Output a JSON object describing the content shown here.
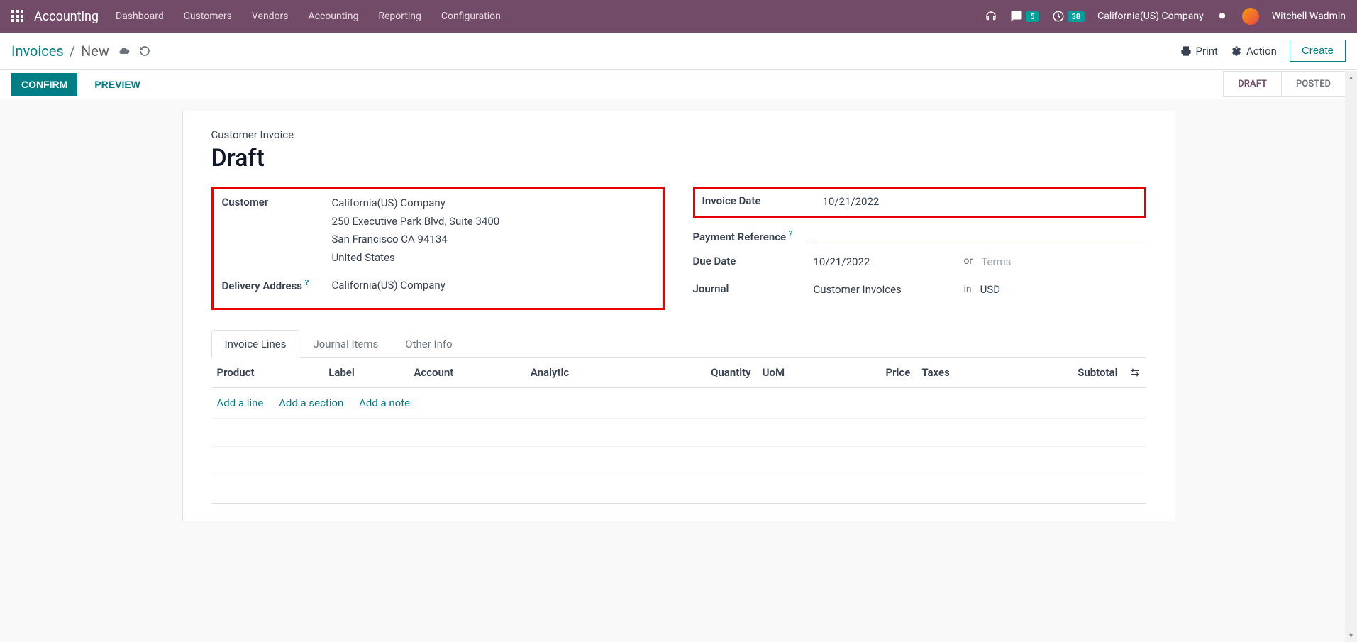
{
  "navbar": {
    "brand": "Accounting",
    "menu": [
      "Dashboard",
      "Customers",
      "Vendors",
      "Accounting",
      "Reporting",
      "Configuration"
    ],
    "messages_count": "5",
    "activities_count": "38",
    "company": "California(US) Company",
    "user": "Witchell Wadmin"
  },
  "control_panel": {
    "breadcrumb_root": "Invoices",
    "breadcrumb_current": "New",
    "print_label": "Print",
    "action_label": "Action",
    "create_label": "Create"
  },
  "status_bar": {
    "confirm": "CONFIRM",
    "preview": "PREVIEW",
    "draft": "DRAFT",
    "posted": "POSTED"
  },
  "form": {
    "subtitle": "Customer Invoice",
    "title": "Draft",
    "left": {
      "customer_label": "Customer",
      "customer_name": "California(US) Company",
      "address_line1": "250 Executive Park Blvd, Suite 3400",
      "address_line2": "San Francisco CA 94134",
      "address_line3": "United States",
      "delivery_label": "Delivery Address",
      "delivery_value": "California(US) Company"
    },
    "right": {
      "invoice_date_label": "Invoice Date",
      "invoice_date_value": "10/21/2022",
      "payment_ref_label": "Payment Reference",
      "payment_ref_value": "",
      "due_date_label": "Due Date",
      "due_date_value": "10/21/2022",
      "due_or": "or",
      "due_terms_placeholder": "Terms",
      "journal_label": "Journal",
      "journal_value": "Customer Invoices",
      "journal_in": "in",
      "journal_currency": "USD"
    },
    "tabs": [
      "Invoice Lines",
      "Journal Items",
      "Other Info"
    ],
    "columns": {
      "product": "Product",
      "label": "Label",
      "account": "Account",
      "analytic": "Analytic",
      "quantity": "Quantity",
      "uom": "UoM",
      "price": "Price",
      "taxes": "Taxes",
      "subtotal": "Subtotal"
    },
    "add_line": "Add a line",
    "add_section": "Add a section",
    "add_note": "Add a note"
  }
}
